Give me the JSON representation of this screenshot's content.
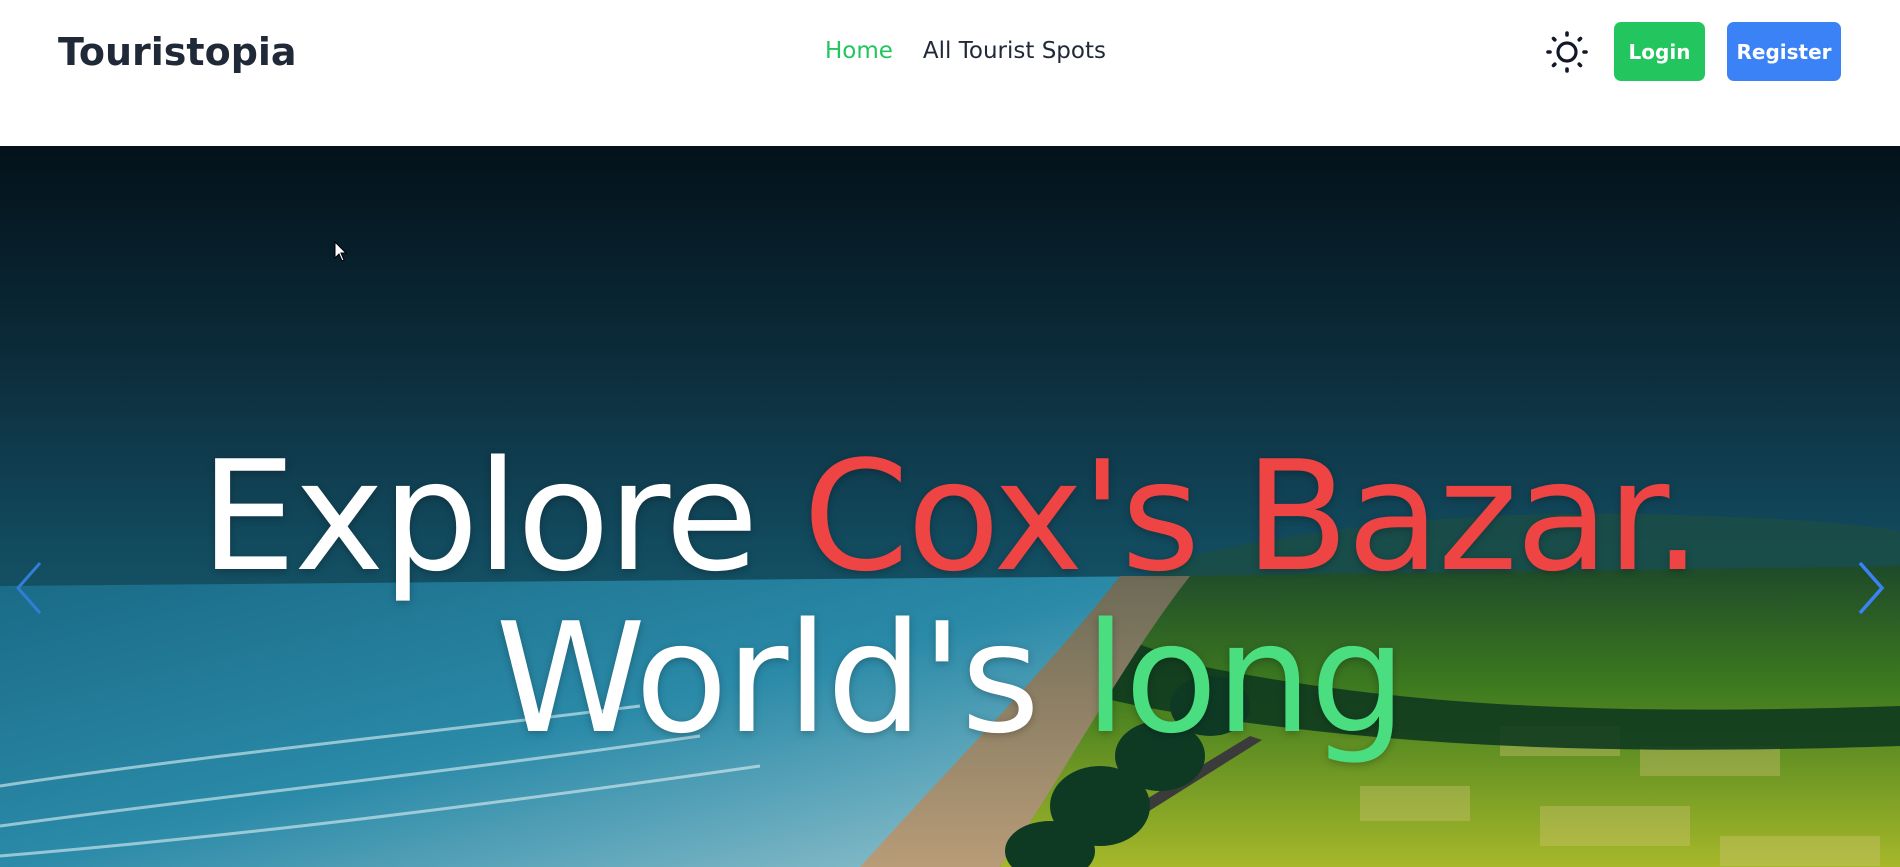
{
  "nav": {
    "brand": "Touristopia",
    "links": [
      {
        "label": "Home",
        "active": true
      },
      {
        "label": "All Tourist Spots",
        "active": false
      }
    ],
    "theme_icon": "sun-icon",
    "login_label": "Login",
    "register_label": "Register"
  },
  "hero": {
    "line1_white": "Explore ",
    "line1_red": "Cox's Bazar.",
    "line2_white": "World's ",
    "line2_green": "long",
    "prev_icon": "chevron-left-icon",
    "next_icon": "chevron-right-icon"
  },
  "colors": {
    "accent_green": "#22c55e",
    "accent_blue": "#3b82f6",
    "title_red": "#ef4444",
    "title_green": "#4ade80"
  }
}
